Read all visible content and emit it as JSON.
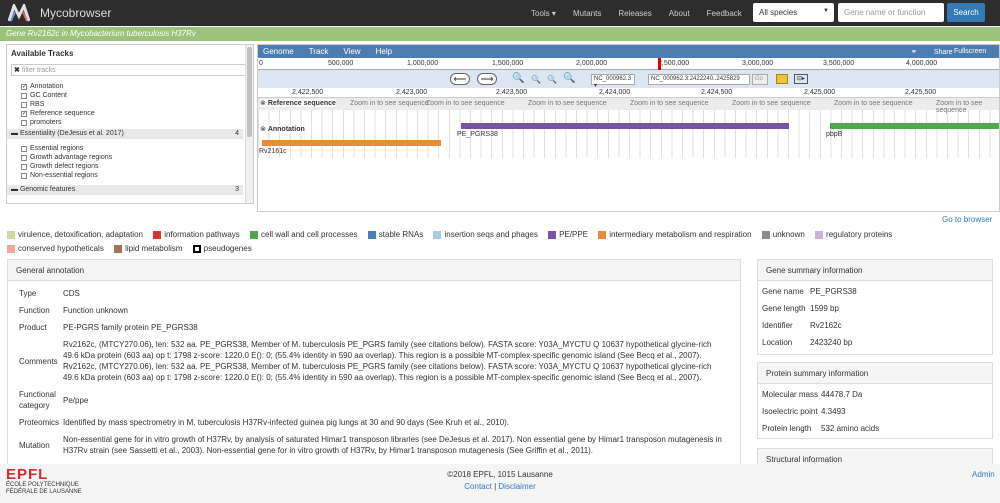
{
  "nav": {
    "brand": "Mycobrowser",
    "tools": "Tools",
    "mutants": "Mutants",
    "releases": "Releases",
    "about": "About",
    "feedback": "Feedback",
    "species": "All species",
    "search_placeholder": "Gene name or function",
    "search_btn": "Search"
  },
  "gene_bar": "Gene Rv2162c in Mycobacterium tuberculosis H37Rv",
  "tracks": {
    "title": "Available Tracks",
    "filter": "filter tracks",
    "items": [
      {
        "label": "Annotation",
        "checked": true
      },
      {
        "label": "GC Content",
        "checked": false
      },
      {
        "label": "RBS",
        "checked": false
      },
      {
        "label": "Reference sequence",
        "checked": true
      },
      {
        "label": "promoters",
        "checked": false
      }
    ],
    "cat1": "Essentiality (DeJesus et al. 2017)",
    "cat1_count": "4",
    "items2": [
      "Essential regions",
      "Growth advantage regions",
      "Growth defect regions",
      "Non-essential regions"
    ],
    "cat2": "Genomic features",
    "cat2_count": "3"
  },
  "browser": {
    "menu": [
      "Genome",
      "Track",
      "View",
      "Help"
    ],
    "share": "Share",
    "fullscreen": "Fullscreen",
    "ruler": [
      "0",
      "500,000",
      "1,000,000",
      "1,500,000",
      "2,000,000",
      "2,500,000",
      "3,000,000",
      "3,500,000",
      "4,000,000"
    ],
    "refseq_select": "NC_000962.3",
    "locus": "NC_000962.3:2422240..2425829",
    "go": "Go",
    "ruler2": [
      "2,422,500",
      "2,423,000",
      "2,423,500",
      "2,424,000",
      "2,424,500",
      "2,425,000",
      "2,425,500"
    ],
    "ref_track": "Reference sequence",
    "zoom_msg": "Zoom in to see sequence",
    "ann_track": "Annotation",
    "features": [
      "PE_PGRS38",
      "Rv2161c",
      "pbpB"
    ],
    "goto": "Go to browser"
  },
  "legend": [
    {
      "label": "virulence, detoxification, adaptation",
      "color": "#c9dba5"
    },
    {
      "label": "information pathways",
      "color": "#d9332b"
    },
    {
      "label": "cell wall and cell processes",
      "color": "#4eaa4a"
    },
    {
      "label": "stable RNAs",
      "color": "#4a7fb5"
    },
    {
      "label": "insertion seqs and phages",
      "color": "#a9cbe3"
    },
    {
      "label": "PE/PPE",
      "color": "#7953a9"
    },
    {
      "label": "intermediary metabolism and respiration",
      "color": "#ea8c3c"
    },
    {
      "label": "unknown",
      "color": "#8c8c8c"
    },
    {
      "label": "regulatory proteins",
      "color": "#c9b3d9"
    },
    {
      "label": "conserved hypotheticals",
      "color": "#f2a5a3"
    },
    {
      "label": "lipid metabolism",
      "color": "#a07656"
    },
    {
      "label": "pseudogenes",
      "color": "#ffffff"
    }
  ],
  "general": {
    "title": "General annotation",
    "rows": [
      {
        "k": "Type",
        "v": "CDS"
      },
      {
        "k": "Function",
        "v": "Function unknown"
      },
      {
        "k": "Product",
        "v": "PE-PGRS family protein PE_PGRS38"
      },
      {
        "k": "Comments",
        "v": "Rv2162c, (MTCY270.06), len: 532 aa. PE_PGRS38, Member of M. tuberculosis PE_PGRS family (see citations below). FASTA score: Y03A_MYCTU Q 10637 hypothetical glycine-rich 49.6 kDa protein (603 aa) op t: 1798 z-score: 1220.0 E(): 0; (55.4% identity in 590 aa overlap). This region is a possible MT-complex-specific genomic island (See Becq et al., 2007). Rv2162c, (MTCY270.06), len: 532 aa. PE_PGRS38, Member of M. tuberculosis PE_PGRS family (see citations below). FASTA score: Y03A_MYCTU Q 10637 hypothetical glycine-rich 49.6 kDa protein (603 aa) op t: 1798 z-score: 1220.0 E(): 0; (55.4% identity in 590 aa overlap). This region is a possible MT-complex-specific genomic island (See Becq et al., 2007)."
      },
      {
        "k": "Functional category",
        "v": "Pe/ppe"
      },
      {
        "k": "Proteomics",
        "v": "Identified by mass spectrometry in M. tuberculosis H37Rv-infected guinea pig lungs at 30 and 90 days (See Kruh et al., 2010)."
      },
      {
        "k": "Mutation",
        "v": "Non-essential gene for in vitro growth of H37Rv, by analysis of saturated Himar1 transposon libraries (see DeJesus et al. 2017). Non essential gene by Himar1 transposon mutagenesis in H37Rv strain (see Sassetti et al., 2003). Non-essential gene for in vitro growth of H37Rv, by Himar1 transposon mutagenesis (See Griffin et al., 2011)."
      }
    ]
  },
  "gene_summary": {
    "title": "Gene summary information",
    "rows": [
      {
        "k": "Gene name",
        "v": "PE_PGRS38"
      },
      {
        "k": "Gene length",
        "v": "1599 bp"
      },
      {
        "k": "Identifier",
        "v": "Rv2162c"
      },
      {
        "k": "Location",
        "v": "2423240 bp"
      }
    ]
  },
  "protein_summary": {
    "title": "Protein summary information",
    "rows": [
      {
        "k": "Molecular mass",
        "v": "44478.7 Da"
      },
      {
        "k": "Isoelectric point",
        "v": "4.3493"
      },
      {
        "k": "Protein length",
        "v": "532 amino acids"
      }
    ]
  },
  "structural": {
    "title": "Structural information"
  },
  "footer": {
    "copyright": "©2018 EPFL, 1015 Lausanne",
    "contact": "Contact",
    "sep": "|",
    "disclaimer": "Disclaimer",
    "admin": "Admin",
    "epfl_logo": "EPFL",
    "epfl_line1": "ÉCOLE POLYTECHNIQUE",
    "epfl_line2": "FÉDÉRALE DE LAUSANNE"
  }
}
